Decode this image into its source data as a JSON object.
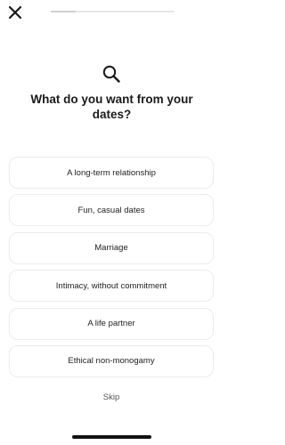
{
  "header": {
    "close_icon": "close-icon",
    "progress": 0.2
  },
  "prompt": {
    "icon": "search-icon",
    "title": "What do you want from your dates?"
  },
  "options": [
    {
      "label": "A long-term relationship"
    },
    {
      "label": "Fun, casual dates"
    },
    {
      "label": "Marriage"
    },
    {
      "label": "Intimacy, without commitment"
    },
    {
      "label": "A life partner"
    },
    {
      "label": "Ethical non-monogamy"
    }
  ],
  "footer": {
    "skip_label": "Skip"
  }
}
